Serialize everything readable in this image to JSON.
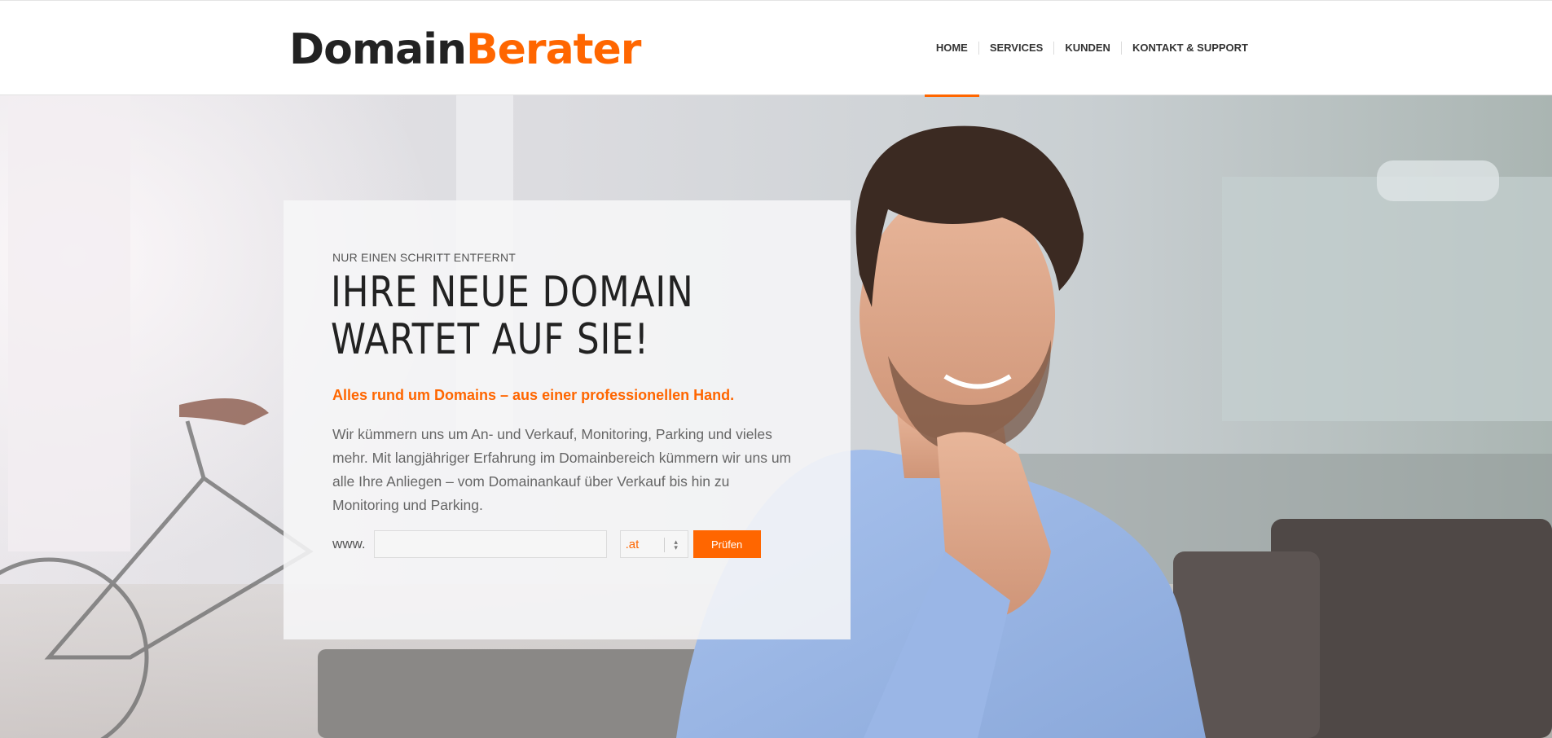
{
  "brand": {
    "part1": "Domain",
    "part2": "Berater",
    "accent": "#ff6600"
  },
  "nav": {
    "items": [
      {
        "label": "HOME",
        "active": true
      },
      {
        "label": "SERVICES",
        "active": false
      },
      {
        "label": "KUNDEN",
        "active": false
      },
      {
        "label": "KONTAKT & SUPPORT",
        "active": false
      }
    ]
  },
  "hero": {
    "kicker": "NUR EINEN SCHRITT ENTFERNT",
    "headline_line1": "IHRE NEUE DOMAIN",
    "headline_line2": "WARTET AUF SIE!",
    "tagline": "Alles rund um Domains – aus einer professionellen Hand.",
    "body": "Wir kümmern uns um An- und Verkauf, Monitoring, Parking und vieles mehr. Mit langjähriger Erfahrung im Domainbereich kümmern wir uns um alle Ihre Anliegen – vom Domainankauf über Verkauf bis hin zu Monitoring und Parking."
  },
  "search": {
    "prefix": "www.",
    "input_value": "",
    "tld_selected": ".at",
    "button_label": "Prüfen"
  }
}
